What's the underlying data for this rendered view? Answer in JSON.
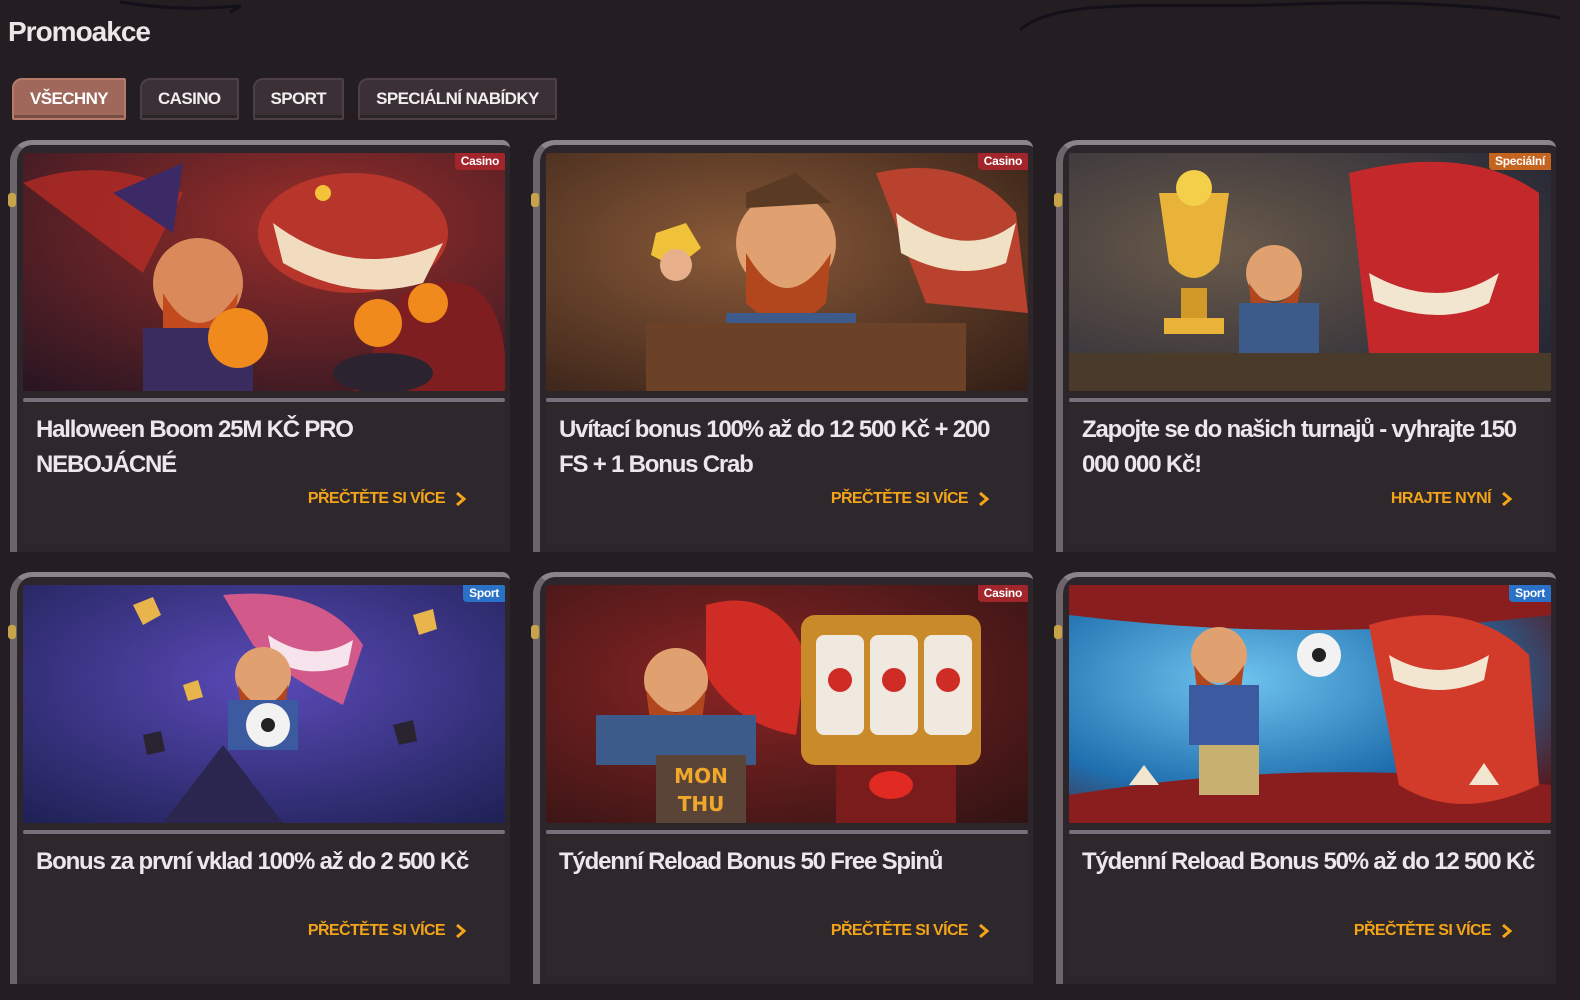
{
  "page": {
    "title": "Promoakce"
  },
  "tabs": [
    {
      "label": "VŠECHNY",
      "active": true
    },
    {
      "label": "CASINO",
      "active": false
    },
    {
      "label": "SPORT",
      "active": false
    },
    {
      "label": "SPECIÁLNÍ NABÍDKY",
      "active": false
    }
  ],
  "promos": [
    {
      "badge": "Casino",
      "badge_type": "casino",
      "title": "Halloween Boom 25M KČ PRO NEBOJÁCNÉ",
      "cta": "PŘEČTĚTE SI VÍCE",
      "art": "halloween-dragon-wizard",
      "palette": [
        "#6a1e22",
        "#b53326",
        "#2b1f3a",
        "#f08a1c"
      ]
    },
    {
      "badge": "Casino",
      "badge_type": "casino",
      "title": "Uvítací bonus 100% až do 12 500 Kč + 200 FS + 1 Bonus Crab",
      "cta": "PŘEČTĚTE SI VÍCE",
      "art": "miner-gold-nugget-dragon",
      "palette": [
        "#3a2418",
        "#7d4a2c",
        "#b8422e",
        "#e8c24a"
      ]
    },
    {
      "badge": "Speciální",
      "badge_type": "special",
      "title": "Zapojte se do našich turnajů - vyhrajte 150 000 000 Kč!",
      "cta": "HRAJTE NYNÍ",
      "art": "golden-trophy-dragon",
      "palette": [
        "#2c3148",
        "#5a4a3a",
        "#c4282b",
        "#e9b33a"
      ]
    },
    {
      "badge": "Sport",
      "badge_type": "sport",
      "title": "Bonus za první vklad 100% až do 2 500 Kč",
      "cta": "PŘEČTĚTE SI VÍCE",
      "art": "miner-football-purple-dragon",
      "palette": [
        "#1e2258",
        "#4a3a9a",
        "#c84a78",
        "#e7b54b"
      ]
    },
    {
      "badge": "Casino",
      "badge_type": "casino",
      "title": "Týdenní Reload Bonus 50 Free Spinů",
      "cta": "PŘEČTĚTE SI VÍCE",
      "art": "miner-slot-machine-dragon",
      "palette": [
        "#3a1616",
        "#7a1c1c",
        "#cf2c25",
        "#e8a23a"
      ],
      "sign_line1": "MON",
      "sign_line2": "THU"
    },
    {
      "badge": "Sport",
      "badge_type": "sport",
      "title": "Týdenní Reload Bonus 50% až do 12 500 Kč",
      "cta": "PŘEČTĚTE SI VÍCE",
      "art": "miner-football-dragon-mouth",
      "palette": [
        "#0f3a6a",
        "#2a86c8",
        "#8a1e1e",
        "#d23a2a"
      ]
    }
  ]
}
